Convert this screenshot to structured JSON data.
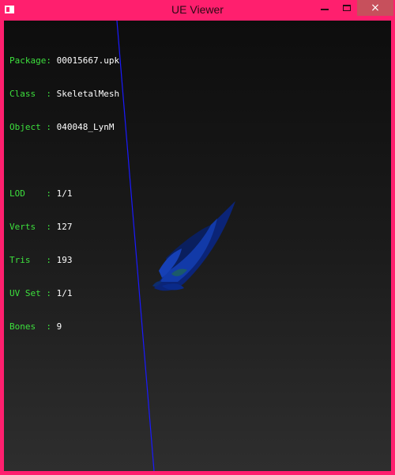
{
  "window": {
    "title": "UE Viewer",
    "minimize_glyph": "minimize-icon",
    "maximize_glyph": "maximize-icon",
    "close_glyph": "×"
  },
  "info": {
    "package": {
      "label": "Package: ",
      "value": "00015667.upk"
    },
    "class": {
      "label": "Class  : ",
      "value": "SkeletalMesh"
    },
    "object": {
      "label": "Object : ",
      "value": "040048_LynM"
    },
    "lod": {
      "label": "LOD    : ",
      "value": "1/1"
    },
    "verts": {
      "label": "Verts  : ",
      "value": "127"
    },
    "tris": {
      "label": "Tris   : ",
      "value": "193"
    },
    "uvset": {
      "label": "UV Set : ",
      "value": "1/1"
    },
    "bones": {
      "label": "Bones  : ",
      "value": "9"
    }
  },
  "colors": {
    "frame": "#ff1f6e",
    "label": "#3de03d",
    "value": "#ffffff",
    "axis": "#1a1aff",
    "mesh": "#0a2a8a"
  }
}
